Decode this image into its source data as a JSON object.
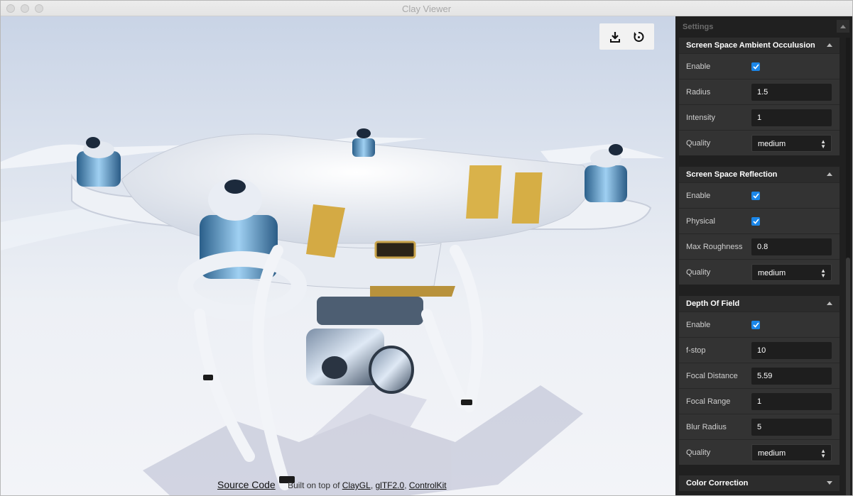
{
  "window": {
    "title": "Clay Viewer"
  },
  "toolbar": {
    "download_icon": "download-icon",
    "reset_icon": "reset-icon"
  },
  "footer": {
    "source_code": "Source Code",
    "built_on": "Built on top of",
    "link1": "ClayGL",
    "sep1": ",",
    "link2": "glTF2.0",
    "sep2": ",",
    "link3": "ControlKit"
  },
  "panel": {
    "title": "Settings",
    "ssao": {
      "title": "Screen Space Ambient Occulusion",
      "enable_label": "Enable",
      "enable": true,
      "radius_label": "Radius",
      "radius": "1.5",
      "intensity_label": "Intensity",
      "intensity": "1",
      "quality_label": "Quality",
      "quality": "medium"
    },
    "ssr": {
      "title": "Screen Space Reflection",
      "enable_label": "Enable",
      "enable": true,
      "physical_label": "Physical",
      "physical": true,
      "roughness_label": "Max Roughness",
      "roughness": "0.8",
      "quality_label": "Quality",
      "quality": "medium"
    },
    "dof": {
      "title": "Depth Of Field",
      "enable_label": "Enable",
      "enable": true,
      "fstop_label": "f-stop",
      "fstop": "10",
      "focal_distance_label": "Focal Distance",
      "focal_distance": "5.59",
      "focal_range_label": "Focal Range",
      "focal_range": "1",
      "blur_radius_label": "Blur Radius",
      "blur_radius": "5",
      "quality_label": "Quality",
      "quality": "medium"
    },
    "color_correction": {
      "title": "Color Correction"
    }
  }
}
